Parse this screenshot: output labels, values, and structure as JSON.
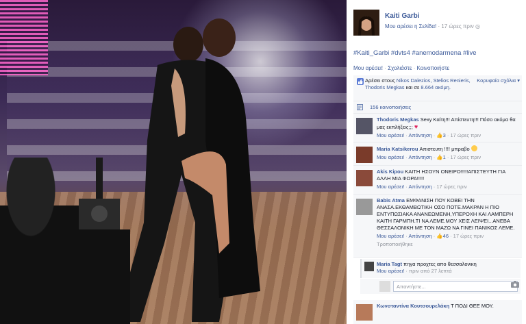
{
  "post": {
    "author": "Kaiti Garbi",
    "like_page": "Μου αρέσει η Σελίδα!",
    "time": "17 ώρες πριν",
    "caption": "#Kaiti_Garbi #dvts4 #anemodarmena #live",
    "actions": [
      "Μου αρέσει!",
      "Σχολιάστε",
      "Κοινοποιήστε"
    ],
    "likes": {
      "prefix": "Αρέσει στους ",
      "names": "Nikos Dalezios, Stelios Renieris, Thodoris Megkas",
      "suffix": " και σε ",
      "others": "8.664 ακόμη."
    },
    "sort_label": "Κορυφαία σχόλια",
    "shares": "156 κοινοποιήσεις"
  },
  "comments": [
    {
      "name": "Thodoris Megkas",
      "text": "Sexy Καίτη!!! Απίστευτη!!! Πόσο ακόμα θα μας εκπλήξεις;;;",
      "like": "Μου αρέσει!",
      "reply": "Απάντηση",
      "count": "3",
      "time": "17 ώρες πριν"
    },
    {
      "name": "Maria Katsikerou",
      "text": "Απιστευτη !!!! μπραβο",
      "like": "Μου αρέσει!",
      "reply": "Απάντηση",
      "count": "1",
      "time": "17 ώρες πριν"
    },
    {
      "name": "Akis Kipou",
      "text": "ΚΑΙΤΗ ΗΣΟΥΝ ΟΝΕΙΡΟ!!!!!ΑΠΙΣΤΕΥΤΗ ΓΙΑ ΑΛΛΗ ΜΙΑ ΦΟΡΑ!!!!!",
      "like": "Μου αρέσει!",
      "reply": "Απάντηση",
      "time": "17 ώρες πριν"
    },
    {
      "name": "Babis Atma",
      "text": "ΕΜΦΑΝΙΣΗ ΠΟΥ ΚΟΒΕΙ ΤΗΝ ΑΝΑΣΑ.ΕΚΘΑΜΒΩΤΙΚΗ ΟΣΟ ΠΟΤΕ.ΜΑΚΡΑΝ Η ΠΙΟ ΕΝΤΥΠΩΣΙΑΚΑ ΑΝΑΝΕΩΜΕΝΗ,ΥΠΕΡΟΧΗ ΚΑΙ ΛΑΜΠΕΡΗ ΚΑΙΤΗ ΓΑΡΜΠΗ.ΤΙ ΝΑ ΛΕΜΕ.ΜΟΥ ΧΕΙΣ ΛΕΙΨΕΙ...ΑΝΕΒΑ ΘΕΣΣΑΛΟΝΙΚΗ ΜΕ ΤΟΝ ΜΑΖΩ ΝΑ ΓΙΝΕΙ ΠΑΝΙΚΟΣ ΛΕΜΕ.",
      "like": "Μου αρέσει!",
      "reply": "Απάντηση",
      "count": "46",
      "time": "17 ώρες πριν",
      "edited": "Τροποποιήθηκε"
    },
    {
      "name": "Κωνσταντίνα Κουτσουρελάκη",
      "text": "Τ ΠΟΔΙ ΘΕΕ ΜΟΥ."
    }
  ],
  "reply_item": {
    "name": "Maria Tagt",
    "text": "πηγα προχτες απο θεσσαλονικη",
    "like": "Μου αρέσει!",
    "time": "πριν από 27 λεπτά"
  },
  "reply_placeholder": "Απαντήστε...",
  "colors": {
    "link": "#3b5998",
    "muted": "#90949c",
    "bg": "#f6f7f9"
  }
}
